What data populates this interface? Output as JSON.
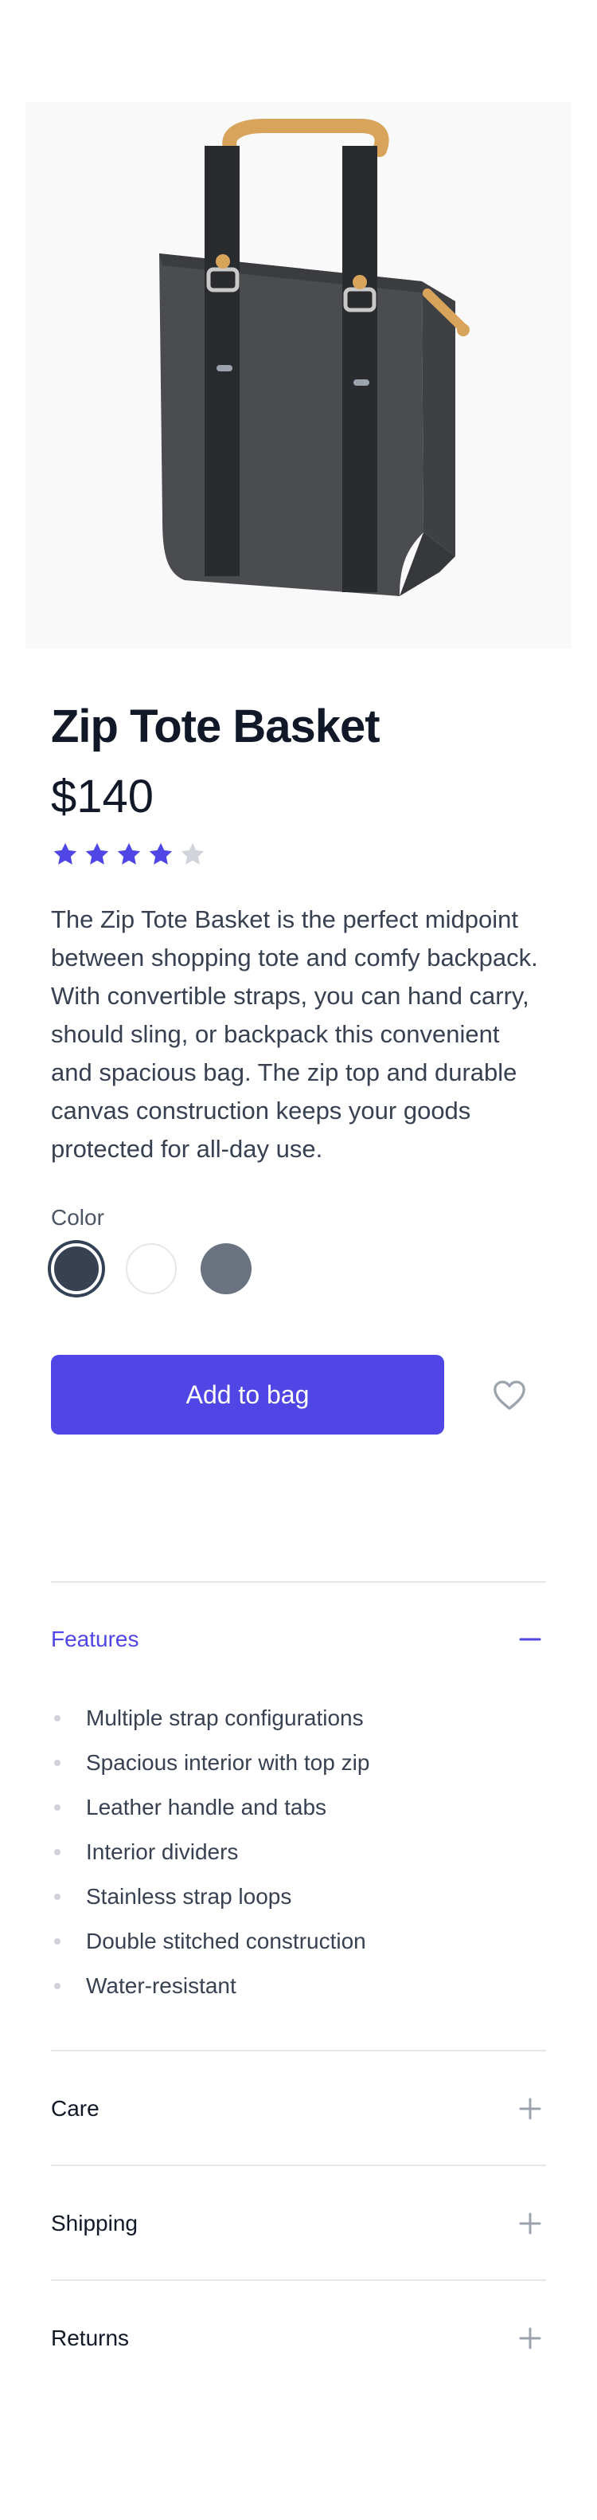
{
  "product": {
    "name": "Zip Tote Basket",
    "price": "$140",
    "rating": 4,
    "rating_max": 5,
    "description": "The Zip Tote Basket is the perfect midpoint between shopping tote and comfy backpack. With convertible straps, you can hand carry, should sling, or backpack this convenient and spacious bag. The zip top and durable canvas construction keeps your goods protected for all-day use."
  },
  "colors": {
    "label": "Color",
    "options": [
      "#374151",
      "#ffffff",
      "#6b7280"
    ],
    "selected_index": 0
  },
  "actions": {
    "add_to_bag": "Add to bag",
    "favorite_icon": "heart-icon"
  },
  "sections": {
    "features": {
      "title": "Features",
      "expanded": true,
      "items": [
        "Multiple strap configurations",
        "Spacious interior with top zip",
        "Leather handle and tabs",
        "Interior dividers",
        "Stainless strap loops",
        "Double stitched construction",
        "Water-resistant"
      ]
    },
    "care": {
      "title": "Care",
      "expanded": false
    },
    "shipping": {
      "title": "Shipping",
      "expanded": false
    },
    "returns": {
      "title": "Returns",
      "expanded": false
    }
  },
  "theme": {
    "accent": "#4f46e5",
    "star_filled": "#4f46e5",
    "star_empty": "#d1d5db"
  }
}
